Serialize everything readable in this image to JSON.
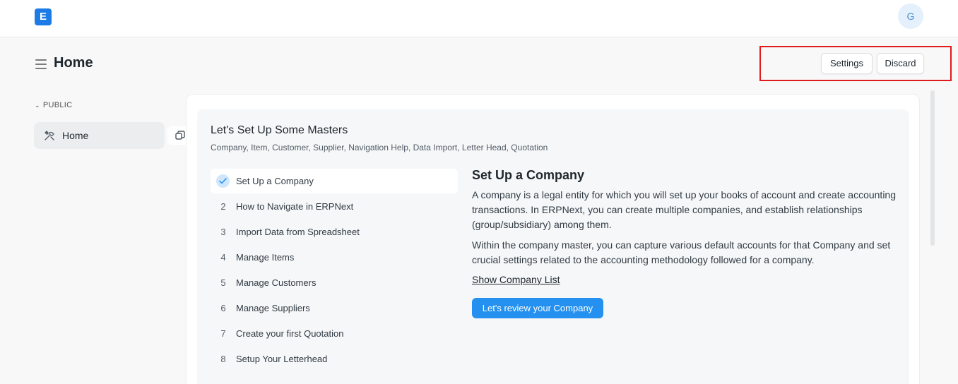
{
  "app": {
    "logo_letter": "E",
    "avatar_initial": "G"
  },
  "header": {
    "title": "Home",
    "settings_label": "Settings",
    "discard_label": "Discard"
  },
  "sidebar": {
    "section_label": "PUBLIC",
    "items": [
      {
        "label": "Home"
      }
    ]
  },
  "onboarding": {
    "title": "Let's Set Up Some Masters",
    "subtitle": "Company, Item, Customer, Supplier, Navigation Help, Data Import, Letter Head, Quotation",
    "steps": [
      {
        "num": "1",
        "label": "Set Up a Company",
        "done": true
      },
      {
        "num": "2",
        "label": "How to Navigate in ERPNext"
      },
      {
        "num": "3",
        "label": "Import Data from Spreadsheet"
      },
      {
        "num": "4",
        "label": "Manage Items"
      },
      {
        "num": "5",
        "label": "Manage Customers"
      },
      {
        "num": "6",
        "label": "Manage Suppliers"
      },
      {
        "num": "7",
        "label": "Create your first Quotation"
      },
      {
        "num": "8",
        "label": "Setup Your Letterhead"
      }
    ],
    "detail": {
      "title": "Set Up a Company",
      "paragraph1": "A company is a legal entity for which you will set up your books of account and create accounting transactions. In ERPNext, you can create multiple companies, and establish relationships (group/subsidiary) among them.",
      "paragraph2": "Within the company master, you can capture various default accounts for that Company and set crucial settings related to the accounting methodology followed for a company.",
      "link_label": "Show Company List",
      "action_label": "Let's review your Company"
    }
  },
  "colors": {
    "primary": "#2490ef",
    "logo": "#1c7be6",
    "highlight": "#e01b1b"
  }
}
